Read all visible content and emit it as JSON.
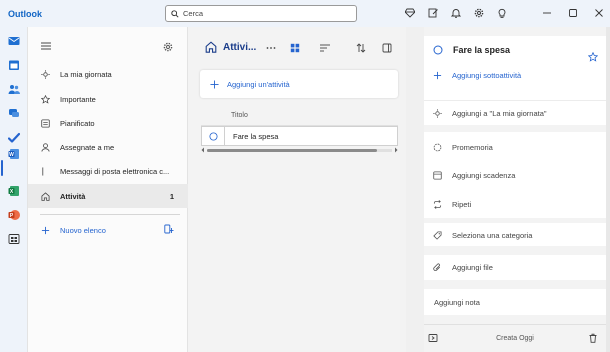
{
  "app": {
    "title": "Outlook"
  },
  "search": {
    "value": "Cerca"
  },
  "sidebar": {
    "items": [
      {
        "label": "La mia giornata",
        "icon": "sun-icon"
      },
      {
        "label": "Importante",
        "icon": "star-icon"
      },
      {
        "label": "Pianificato",
        "icon": "calendar-grid-icon"
      },
      {
        "label": "Assegnate a me",
        "icon": "person-icon"
      },
      {
        "label": "Messaggi di posta elettronica c...",
        "icon": "flag-icon"
      },
      {
        "label": "Attività",
        "icon": "home-icon",
        "count": "1",
        "active": true
      }
    ],
    "new_list": "Nuovo elenco"
  },
  "main": {
    "list_title": "Attivi...",
    "add_task": "Aggiungi un'attività",
    "table": {
      "column_header": "Titolo",
      "rows": [
        {
          "title": "Fare la spesa"
        }
      ]
    }
  },
  "detail": {
    "task_title": "Fare la spesa",
    "add_subtask": "Aggiungi sottoattività",
    "add_my_day": "Aggiungi a \"La mia giornata\"",
    "reminder": "Promemoria",
    "due_date": "Aggiungi scadenza",
    "repeat": "Ripeti",
    "category": "Seleziona una categoria",
    "add_file": "Aggiungi file",
    "add_note": "Aggiungi nota",
    "footer_text": "Creata Oggi"
  },
  "colors": {
    "accent": "#2564cf",
    "brand": "#1366c5"
  }
}
